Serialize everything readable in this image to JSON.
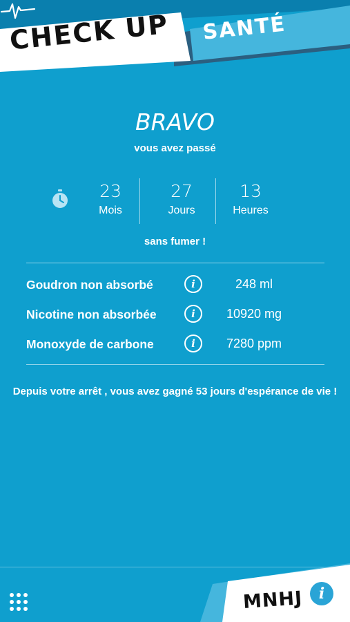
{
  "header": {
    "title_main": "CHECK UP",
    "title_accent": "SANTÉ"
  },
  "result": {
    "headline": "BRAVO",
    "subtitle": "vous avez passé",
    "counters": [
      {
        "value": "23",
        "unit": "Mois"
      },
      {
        "value": "27",
        "unit": "Jours"
      },
      {
        "value": "13",
        "unit": "Heures"
      }
    ],
    "suffix": "sans fumer !"
  },
  "stats": [
    {
      "label": "Goudron non absorbé",
      "value": "248 ml"
    },
    {
      "label": "Nicotine non absorbée",
      "value": "10920 mg"
    },
    {
      "label": "Monoxyde de carbone",
      "value": "7280 ppm"
    }
  ],
  "stat_info_glyph": "i",
  "message": "Depuis votre arrêt , vous avez gagné 53 jours d'espérance de vie !",
  "footer": {
    "brand": "MNHJ",
    "info_glyph": "i"
  },
  "colors": {
    "background": "#0f9fce",
    "header_band": "#0a7fae",
    "accent": "#45b6dd",
    "text": "#ffffff",
    "dark_text": "#111111"
  },
  "icons": {
    "timer": "stopwatch-icon",
    "pulse": "heartbeat-icon",
    "menu": "grid-menu-icon",
    "info": "info-icon"
  }
}
